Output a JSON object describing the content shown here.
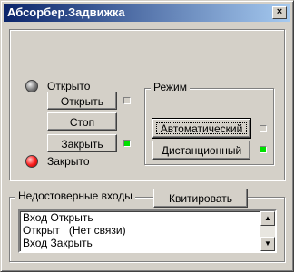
{
  "window": {
    "title": "Абсорбер.Задвижка",
    "close_glyph": "×"
  },
  "valve": {
    "status_open_label": "Открыто",
    "status_closed_label": "Закрыто",
    "open_button": "Открыть",
    "stop_button": "Стоп",
    "close_button": "Закрыть"
  },
  "mode": {
    "group_label": "Режим",
    "auto_button": "Автоматический",
    "remote_button": "Дистанционный"
  },
  "inputs": {
    "group_label": "Недостоверные входы",
    "ack_button": "Квитировать",
    "items": [
      "Вход Открыть",
      "Открыт   (Нет связи)",
      "Вход Закрыть"
    ]
  },
  "colors": {
    "indicator_on": "#00e000",
    "led_closed": "#ff2020",
    "led_open": "#7a7a7a",
    "title_bar": "#0a246a"
  }
}
